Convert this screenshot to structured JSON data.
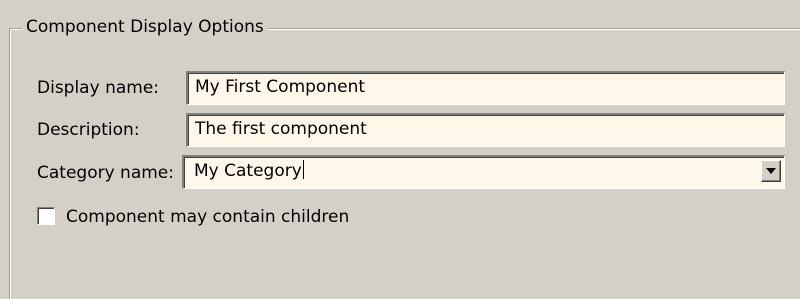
{
  "group": {
    "title": "Component Display Options"
  },
  "fields": {
    "display_name": {
      "label": "Display name:",
      "value": "My First Component"
    },
    "description": {
      "label": "Description:",
      "value": "The first component"
    },
    "category": {
      "label": "Category name:",
      "value": "My Category"
    }
  },
  "options": {
    "may_contain_children": {
      "label": "Component may contain children",
      "checked": false
    }
  }
}
